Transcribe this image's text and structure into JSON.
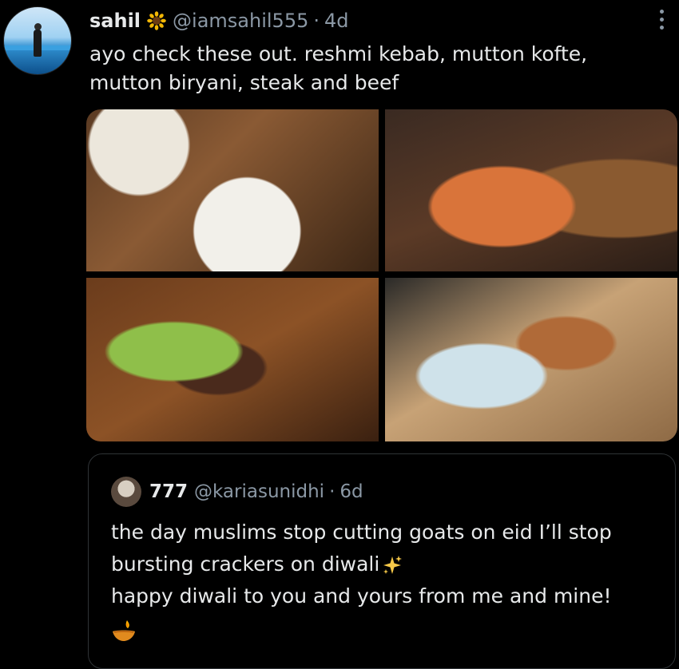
{
  "post": {
    "display_name": "sahil",
    "handle": "@iamsahil555",
    "separator": "·",
    "time": "4d",
    "text_line1": "ayo check these out. reshmi kebab, mutton kofte,",
    "text_line2": "mutton biryani, steak and beef",
    "verified_icon": "sunflower-icon",
    "more_icon": "more-vertical-icon"
  },
  "media": {
    "photos": [
      {
        "alt": "rice and grilled meat plate"
      },
      {
        "alt": "biryani with lamb shank"
      },
      {
        "alt": "salad and grilled meat on wooden board"
      },
      {
        "alt": "noodle dish and copper pan"
      }
    ]
  },
  "quote": {
    "display_name": "777",
    "handle": "@kariasunidhi",
    "separator": "·",
    "time": "6d",
    "line1": "the day muslims stop cutting goats on eid I’ll stop",
    "line2": "bursting crackers on diwali",
    "line3": "happy diwali to you and yours from me and mine!",
    "sparkles_icon": "sparkles-icon",
    "diya_icon": "diya-lamp-icon"
  },
  "colors": {
    "background": "#000000",
    "text": "#e7e9ea",
    "secondary": "#8b98a5",
    "border": "#2f3336"
  }
}
